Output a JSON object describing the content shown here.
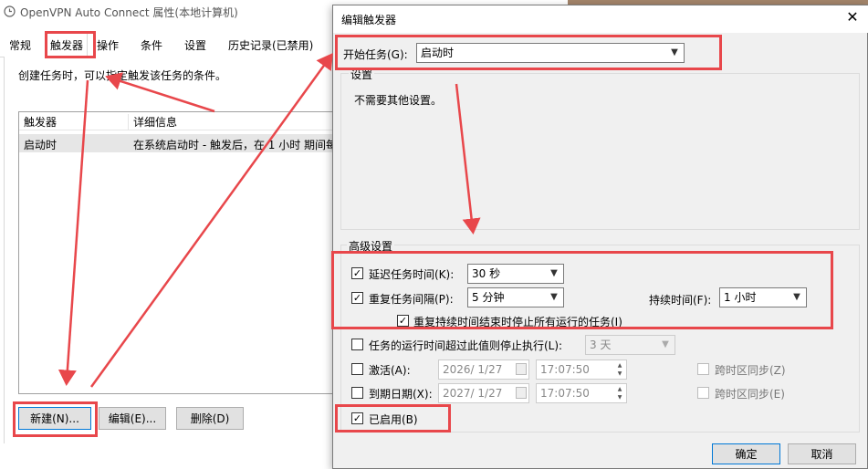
{
  "background_window": {
    "title": "OpenVPN Auto Connect 属性(本地计算机)",
    "tabs": [
      {
        "label": "常规"
      },
      {
        "label": "触发器"
      },
      {
        "label": "操作"
      },
      {
        "label": "条件"
      },
      {
        "label": "设置"
      },
      {
        "label": "历史记录(已禁用)"
      }
    ],
    "active_tab": "触发器",
    "description": "创建任务时，可以指定触发该任务的条件。",
    "trigger_table": {
      "columns": [
        "触发器",
        "详细信息"
      ],
      "rows": [
        {
          "trigger": "启动时",
          "details": "在系统启动时 - 触发后，在 1 小时 期间每"
        }
      ]
    },
    "buttons": {
      "new": "新建(N)...",
      "edit": "编辑(E)...",
      "delete": "删除(D)"
    }
  },
  "dialog": {
    "title": "编辑触发器",
    "close_label": "✕",
    "begin_task": {
      "label": "开始任务(G):",
      "value": "启动时"
    },
    "settings": {
      "label": "设置",
      "text": "不需要其他设置。"
    },
    "advanced": {
      "label": "高级设置",
      "delay": {
        "label": "延迟任务时间(K):",
        "checked": true,
        "value": "30 秒"
      },
      "repeat": {
        "label": "重复任务间隔(P):",
        "checked": true,
        "value": "5 分钟"
      },
      "duration": {
        "label": "持续时间(F):",
        "value": "1 小时"
      },
      "stop_all": {
        "label": "重复持续时间结束时停止所有运行的任务(I)",
        "checked": true
      },
      "stop_longer": {
        "label": "任务的运行时间超过此值则停止执行(L):",
        "checked": false,
        "value": "3 天"
      },
      "activate": {
        "label": "激活(A):",
        "checked": false,
        "date": "2026/ 1/27",
        "time": "17:07:50",
        "sync_label": "跨时区同步(Z)"
      },
      "expire": {
        "label": "到期日期(X):",
        "checked": false,
        "date": "2027/ 1/27",
        "time": "17:07:50",
        "sync_label": "跨时区同步(E)"
      },
      "enabled": {
        "label": "已启用(B)",
        "checked": true
      }
    },
    "buttons": {
      "ok": "确定",
      "cancel": "取消"
    }
  },
  "colors": {
    "annotation": "#e8474b",
    "focus": "#0078d7",
    "dialog_bg": "#f0f0f0"
  }
}
